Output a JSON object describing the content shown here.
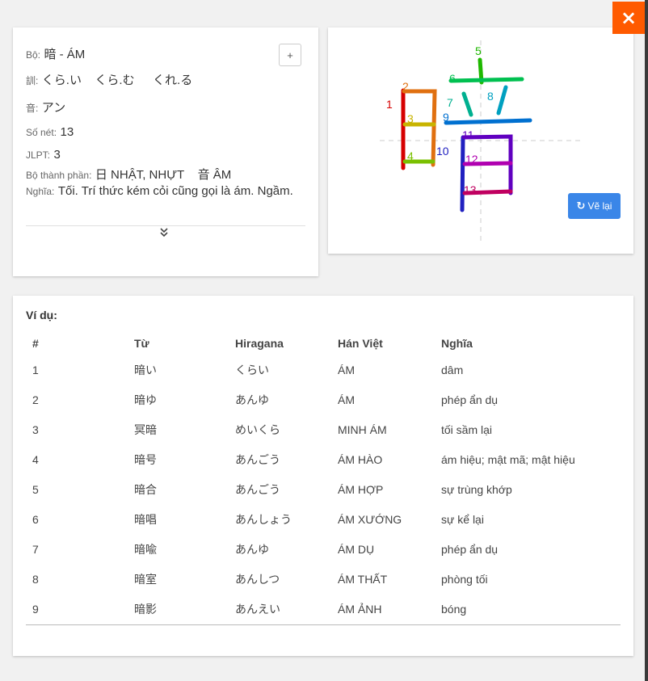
{
  "close": {
    "label": "×"
  },
  "info": {
    "radical_label": "Bộ:",
    "radical_value": "暗 - ÁM",
    "kun_label": "訓:",
    "kun_values": [
      "くら.い",
      "くら.む",
      "くれ.る"
    ],
    "on_label": "音:",
    "on_value": "アン",
    "strokes_label": "Số nét:",
    "strokes_value": "13",
    "jlpt_label": "JLPT:",
    "jlpt_value": "3",
    "components_label": "Bộ thành phần:",
    "components_value": "日 NHẬT, NHỰT    音 ÂM",
    "meaning_label": "Nghĩa:",
    "meaning_value": "Tối. Trí thức kém cỏi cũng gọi là ám. Ngầm.",
    "plus_label": "+",
    "expand_icon": "double-chevron-down-icon"
  },
  "stroke_order": {
    "stroke_numbers": [
      "1",
      "2",
      "3",
      "4",
      "5",
      "6",
      "7",
      "8",
      "9",
      "10",
      "11",
      "12",
      "13"
    ],
    "redraw_label": "Vẽ lại",
    "redraw_icon": "refresh-icon",
    "colors": {
      "s1": "#d60000",
      "s2": "#e07010",
      "s3": "#c8b400",
      "s4": "#7ac000",
      "s5": "#1fb800",
      "s6": "#00c050",
      "s7": "#00b090",
      "s8": "#00a0c0",
      "s9": "#0070d0",
      "s10": "#2020c0",
      "s11": "#6000c0",
      "s12": "#b000b0",
      "s13": "#c00060"
    }
  },
  "examples": {
    "title": "Ví dụ:",
    "headers": [
      "#",
      "Từ",
      "Hiragana",
      "Hán Việt",
      "Nghĩa"
    ],
    "rows": [
      [
        "1",
        "暗い",
        "くらい",
        "ÁM",
        "dâm"
      ],
      [
        "2",
        "暗ゆ",
        "あんゆ",
        "ÁM",
        "phép ẩn dụ"
      ],
      [
        "3",
        "冥暗",
        "めいくら",
        "MINH ÁM",
        "tối sầm lại"
      ],
      [
        "4",
        "暗号",
        "あんごう",
        "ÁM HÀO",
        "ám hiệu; mật mã; mật hiệu"
      ],
      [
        "5",
        "暗合",
        "あんごう",
        "ÁM HỢP",
        "sự trùng khớp"
      ],
      [
        "6",
        "暗唱",
        "あんしょう",
        "ÁM XƯỚNG",
        "sự kể lại"
      ],
      [
        "7",
        "暗喩",
        "あんゆ",
        "ÁM DỤ",
        "phép ẩn dụ"
      ],
      [
        "8",
        "暗室",
        "あんしつ",
        "ÁM THẤT",
        "phòng tối"
      ],
      [
        "9",
        "暗影",
        "あんえい",
        "ÁM ẢNH",
        "bóng"
      ]
    ]
  }
}
